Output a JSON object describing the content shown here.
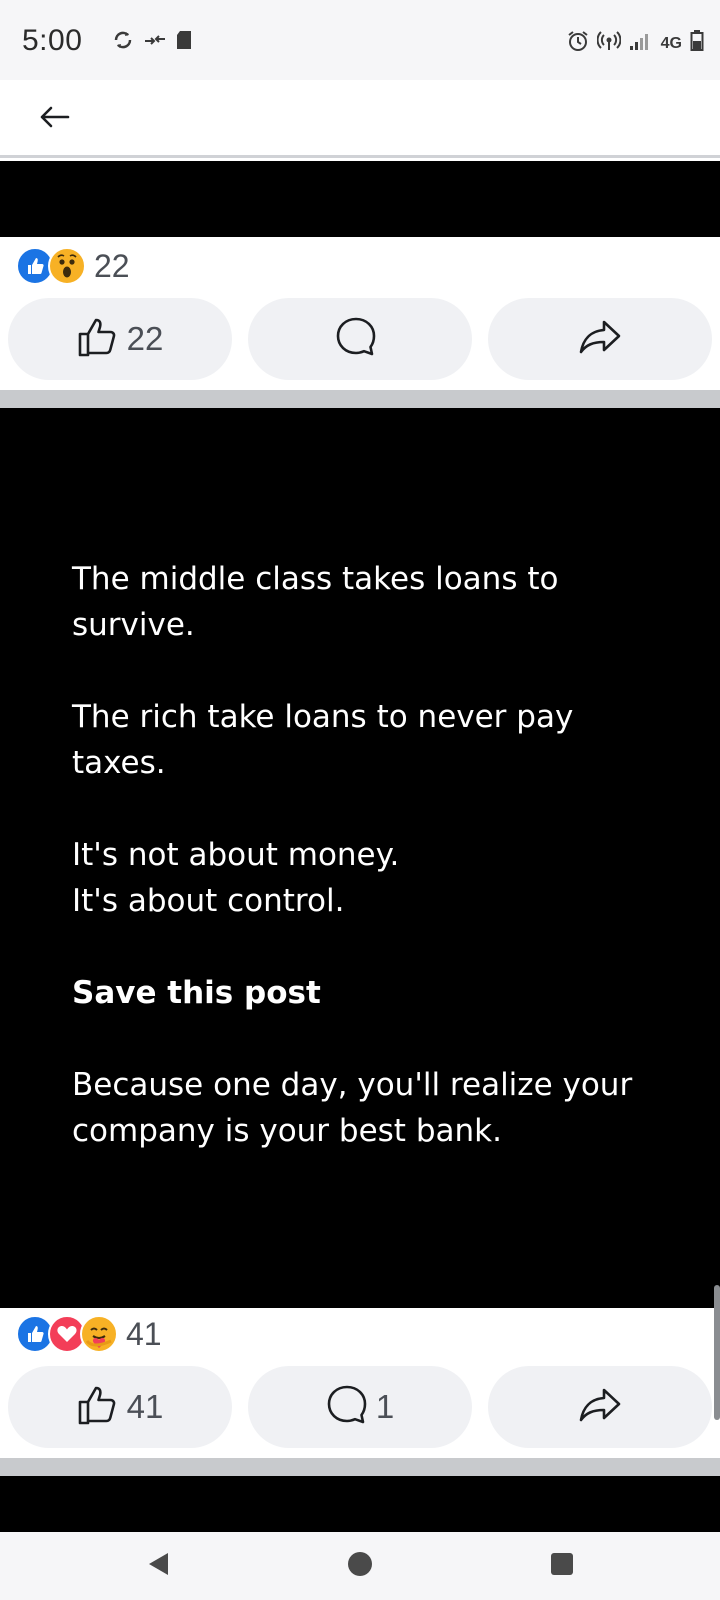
{
  "status_bar": {
    "time": "5:00",
    "network": "4G",
    "icons": [
      "sync-icon",
      "data-transfer-icon",
      "sd-card-icon",
      "alarm-icon",
      "hotspot-icon",
      "signal-icon",
      "battery-icon"
    ]
  },
  "header": {
    "back_icon": "arrow-left-icon"
  },
  "post1": {
    "reactions": [
      "like",
      "wow"
    ],
    "reaction_count": "22",
    "like_count": "22",
    "comment_count": "",
    "share_icon": "share-icon"
  },
  "post2": {
    "text": {
      "line1": "The middle class takes loans to survive.",
      "line2": "The rich take loans to never pay taxes.",
      "line3a": "It's not about money.",
      "line3b": "It's about control.",
      "line4": "Save this post",
      "line5": "Because one day, you'll realize your company is your best bank."
    },
    "reactions": [
      "like",
      "love",
      "care"
    ],
    "reaction_count": "41",
    "like_count": "41",
    "comment_count": "1",
    "share_icon": "share-icon"
  },
  "nav_bar": {
    "icons": [
      "back-triangle-icon",
      "home-circle-icon",
      "recents-square-icon"
    ]
  },
  "colors": {
    "like_blue": "#1b74e4",
    "love_red": "#f33e58",
    "wow_yellow": "#f7b125",
    "button_bg": "#f0f1f4",
    "divider": "#c8cacd"
  }
}
